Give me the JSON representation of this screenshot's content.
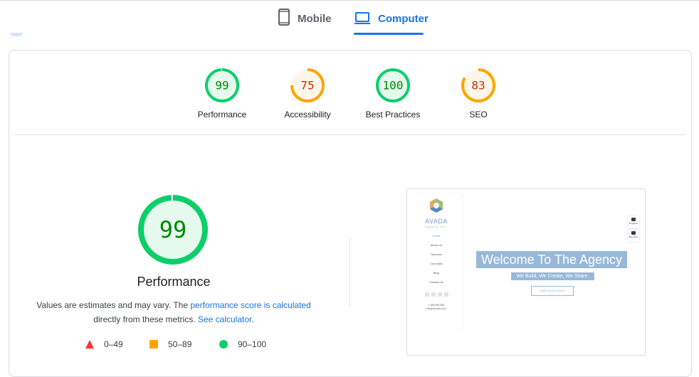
{
  "tabs": [
    {
      "id": "mobile",
      "label": "Mobile",
      "icon": "smartphone-icon",
      "active": false
    },
    {
      "id": "computer",
      "label": "Computer",
      "icon": "laptop-icon",
      "active": true
    }
  ],
  "colors": {
    "pass": "#0cce6b",
    "pass_text": "#008800",
    "pass_fill": "#e5f9ee",
    "average": "#ffa400",
    "average_text": "#c33300",
    "average_fill": "#fff6ea",
    "fail": "#ff3333",
    "link": "#1a73e8"
  },
  "categories": [
    {
      "label": "Performance",
      "score": 99,
      "rating": "pass"
    },
    {
      "label": "Accessibility",
      "score": 75,
      "rating": "average"
    },
    {
      "label": "Best Practices",
      "score": 100,
      "rating": "pass"
    },
    {
      "label": "SEO",
      "score": 83,
      "rating": "average"
    }
  ],
  "performance": {
    "score": 99,
    "title": "Performance",
    "description_prefix": "Values are estimates and may vary. The ",
    "link1": "performance score is calculated",
    "description_mid": " directly from these metrics. ",
    "link2": "See calculator",
    "description_suffix": "."
  },
  "legend": [
    {
      "shape": "triangle",
      "range": "0–49",
      "color": "#ff3333"
    },
    {
      "shape": "square",
      "range": "50–89",
      "color": "#ffa400"
    },
    {
      "shape": "circle",
      "range": "90–100",
      "color": "#0cce6b"
    }
  ],
  "screenshot": {
    "brand": "AVADA",
    "brand_sub": "Agency Inc.",
    "nav": [
      "Home",
      "About Us",
      "Services",
      "Our Work",
      "Blog",
      "Contact Us"
    ],
    "contact_phone": "1.555.555.555",
    "contact_email": "info@domain.com",
    "hero_title": "Welcome To The Agency",
    "hero_tagline": "We Build, We Create, We Share.",
    "hero_button": "PURCHASE AVADA",
    "float_buttons": [
      "Products",
      "Buy Now"
    ]
  }
}
